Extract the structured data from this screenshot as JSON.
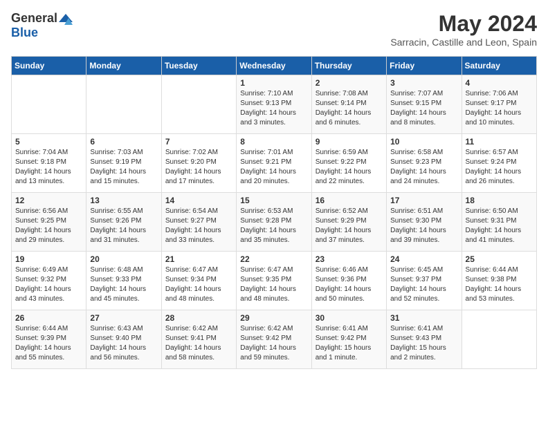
{
  "header": {
    "logo_general": "General",
    "logo_blue": "Blue",
    "month_title": "May 2024",
    "location": "Sarracin, Castille and Leon, Spain"
  },
  "days_of_week": [
    "Sunday",
    "Monday",
    "Tuesday",
    "Wednesday",
    "Thursday",
    "Friday",
    "Saturday"
  ],
  "weeks": [
    [
      {
        "day": "",
        "content": ""
      },
      {
        "day": "",
        "content": ""
      },
      {
        "day": "",
        "content": ""
      },
      {
        "day": "1",
        "content": "Sunrise: 7:10 AM\nSunset: 9:13 PM\nDaylight: 14 hours and 3 minutes."
      },
      {
        "day": "2",
        "content": "Sunrise: 7:08 AM\nSunset: 9:14 PM\nDaylight: 14 hours and 6 minutes."
      },
      {
        "day": "3",
        "content": "Sunrise: 7:07 AM\nSunset: 9:15 PM\nDaylight: 14 hours and 8 minutes."
      },
      {
        "day": "4",
        "content": "Sunrise: 7:06 AM\nSunset: 9:17 PM\nDaylight: 14 hours and 10 minutes."
      }
    ],
    [
      {
        "day": "5",
        "content": "Sunrise: 7:04 AM\nSunset: 9:18 PM\nDaylight: 14 hours and 13 minutes."
      },
      {
        "day": "6",
        "content": "Sunrise: 7:03 AM\nSunset: 9:19 PM\nDaylight: 14 hours and 15 minutes."
      },
      {
        "day": "7",
        "content": "Sunrise: 7:02 AM\nSunset: 9:20 PM\nDaylight: 14 hours and 17 minutes."
      },
      {
        "day": "8",
        "content": "Sunrise: 7:01 AM\nSunset: 9:21 PM\nDaylight: 14 hours and 20 minutes."
      },
      {
        "day": "9",
        "content": "Sunrise: 6:59 AM\nSunset: 9:22 PM\nDaylight: 14 hours and 22 minutes."
      },
      {
        "day": "10",
        "content": "Sunrise: 6:58 AM\nSunset: 9:23 PM\nDaylight: 14 hours and 24 minutes."
      },
      {
        "day": "11",
        "content": "Sunrise: 6:57 AM\nSunset: 9:24 PM\nDaylight: 14 hours and 26 minutes."
      }
    ],
    [
      {
        "day": "12",
        "content": "Sunrise: 6:56 AM\nSunset: 9:25 PM\nDaylight: 14 hours and 29 minutes."
      },
      {
        "day": "13",
        "content": "Sunrise: 6:55 AM\nSunset: 9:26 PM\nDaylight: 14 hours and 31 minutes."
      },
      {
        "day": "14",
        "content": "Sunrise: 6:54 AM\nSunset: 9:27 PM\nDaylight: 14 hours and 33 minutes."
      },
      {
        "day": "15",
        "content": "Sunrise: 6:53 AM\nSunset: 9:28 PM\nDaylight: 14 hours and 35 minutes."
      },
      {
        "day": "16",
        "content": "Sunrise: 6:52 AM\nSunset: 9:29 PM\nDaylight: 14 hours and 37 minutes."
      },
      {
        "day": "17",
        "content": "Sunrise: 6:51 AM\nSunset: 9:30 PM\nDaylight: 14 hours and 39 minutes."
      },
      {
        "day": "18",
        "content": "Sunrise: 6:50 AM\nSunset: 9:31 PM\nDaylight: 14 hours and 41 minutes."
      }
    ],
    [
      {
        "day": "19",
        "content": "Sunrise: 6:49 AM\nSunset: 9:32 PM\nDaylight: 14 hours and 43 minutes."
      },
      {
        "day": "20",
        "content": "Sunrise: 6:48 AM\nSunset: 9:33 PM\nDaylight: 14 hours and 45 minutes."
      },
      {
        "day": "21",
        "content": "Sunrise: 6:47 AM\nSunset: 9:34 PM\nDaylight: 14 hours and 48 minutes."
      },
      {
        "day": "22",
        "content": "Sunrise: 6:47 AM\nSunset: 9:35 PM\nDaylight: 14 hours and 48 minutes."
      },
      {
        "day": "23",
        "content": "Sunrise: 6:46 AM\nSunset: 9:36 PM\nDaylight: 14 hours and 50 minutes."
      },
      {
        "day": "24",
        "content": "Sunrise: 6:45 AM\nSunset: 9:37 PM\nDaylight: 14 hours and 52 minutes."
      },
      {
        "day": "25",
        "content": "Sunrise: 6:44 AM\nSunset: 9:38 PM\nDaylight: 14 hours and 53 minutes."
      }
    ],
    [
      {
        "day": "26",
        "content": "Sunrise: 6:44 AM\nSunset: 9:39 PM\nDaylight: 14 hours and 55 minutes."
      },
      {
        "day": "27",
        "content": "Sunrise: 6:43 AM\nSunset: 9:40 PM\nDaylight: 14 hours and 56 minutes."
      },
      {
        "day": "28",
        "content": "Sunrise: 6:42 AM\nSunset: 9:41 PM\nDaylight: 14 hours and 58 minutes."
      },
      {
        "day": "29",
        "content": "Sunrise: 6:42 AM\nSunset: 9:42 PM\nDaylight: 14 hours and 59 minutes."
      },
      {
        "day": "30",
        "content": "Sunrise: 6:41 AM\nSunset: 9:42 PM\nDaylight: 15 hours and 1 minute."
      },
      {
        "day": "31",
        "content": "Sunrise: 6:41 AM\nSunset: 9:43 PM\nDaylight: 15 hours and 2 minutes."
      },
      {
        "day": "",
        "content": ""
      }
    ]
  ]
}
